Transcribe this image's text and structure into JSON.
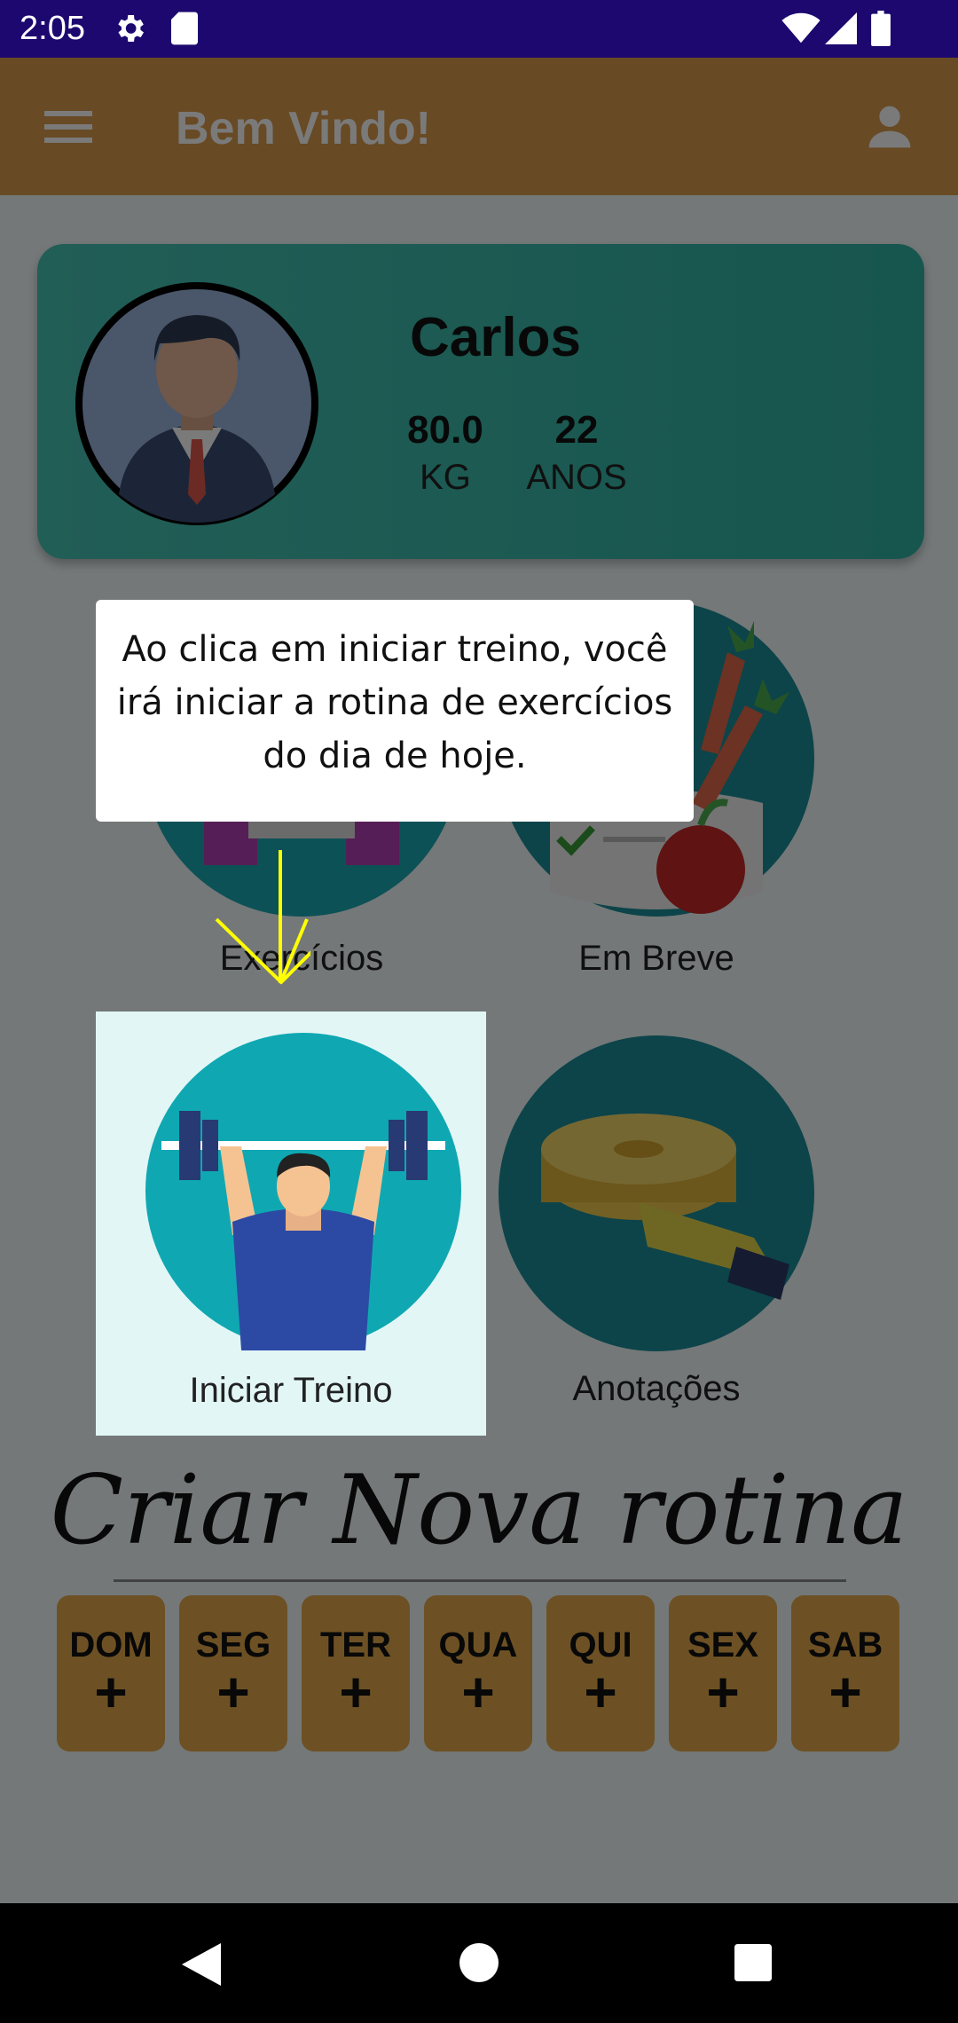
{
  "status": {
    "time": "2:05"
  },
  "appbar": {
    "title": "Bem Vindo!"
  },
  "profile": {
    "name": "Carlos",
    "weight": "80.0",
    "weight_unit": "KG",
    "age": "22",
    "age_unit": "ANOS"
  },
  "menu": [
    {
      "label": "Exercícios"
    },
    {
      "label": "Em Breve"
    },
    {
      "label": "Iniciar Treino"
    },
    {
      "label": "Anotações"
    }
  ],
  "routine": {
    "title": "Criar Nova rotina",
    "days": [
      "DOM",
      "SEG",
      "TER",
      "QUA",
      "QUI",
      "SEX",
      "SAB"
    ],
    "plus": "+"
  },
  "tutorial": {
    "line1": "Ao clica em iniciar treino, você",
    "line2": "irá iniciar a rotina de exercícios",
    "line3": "do dia de  hoje."
  },
  "colors": {
    "appbar": "#d99c4d",
    "status_bar": "#1d0870",
    "card": "#3fbfae",
    "day_button": "#e4a94d",
    "arrow": "#ffff00"
  },
  "icons": [
    "menu-icon",
    "person-icon",
    "settings-icon",
    "sd-card-icon",
    "wifi-icon",
    "signal-icon",
    "battery-icon",
    "back-icon",
    "home-icon",
    "recents-icon"
  ]
}
